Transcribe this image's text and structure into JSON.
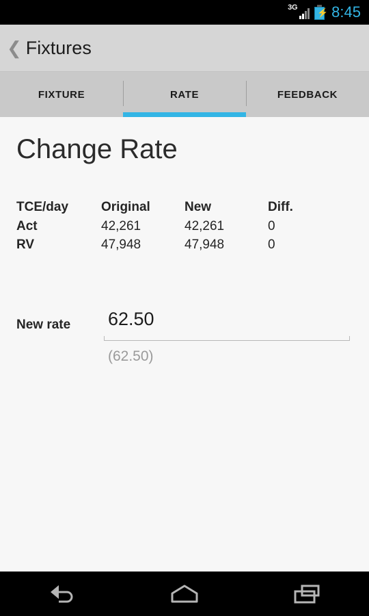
{
  "status_bar": {
    "network_label": "3G",
    "signal_icon": "signal-bars-icon",
    "battery_icon": "battery-charging-icon",
    "battery_bolt": "⚡",
    "clock": "8:45",
    "accent_color": "#33b5e5"
  },
  "action_bar": {
    "back_icon": "❮",
    "title": "Fixtures"
  },
  "tabs": {
    "active_index": 1,
    "items": [
      {
        "label": "FIXTURE"
      },
      {
        "label": "RATE"
      },
      {
        "label": "FEEDBACK"
      }
    ],
    "indicator_color": "#33b5e5"
  },
  "main": {
    "heading": "Change Rate",
    "table": {
      "headers": [
        "TCE/day",
        "Original",
        "New",
        "Diff."
      ],
      "rows": [
        [
          "Act",
          "42,261",
          "42,261",
          "0"
        ],
        [
          "RV",
          "47,948",
          "47,948",
          "0"
        ]
      ]
    },
    "field": {
      "label": "New rate",
      "value": "62.50",
      "placeholder": "62.50",
      "hint": "(62.50)"
    }
  },
  "nav_bar": {
    "back_icon": "back-arrow-icon",
    "home_icon": "home-icon",
    "recents_icon": "recent-apps-icon"
  }
}
